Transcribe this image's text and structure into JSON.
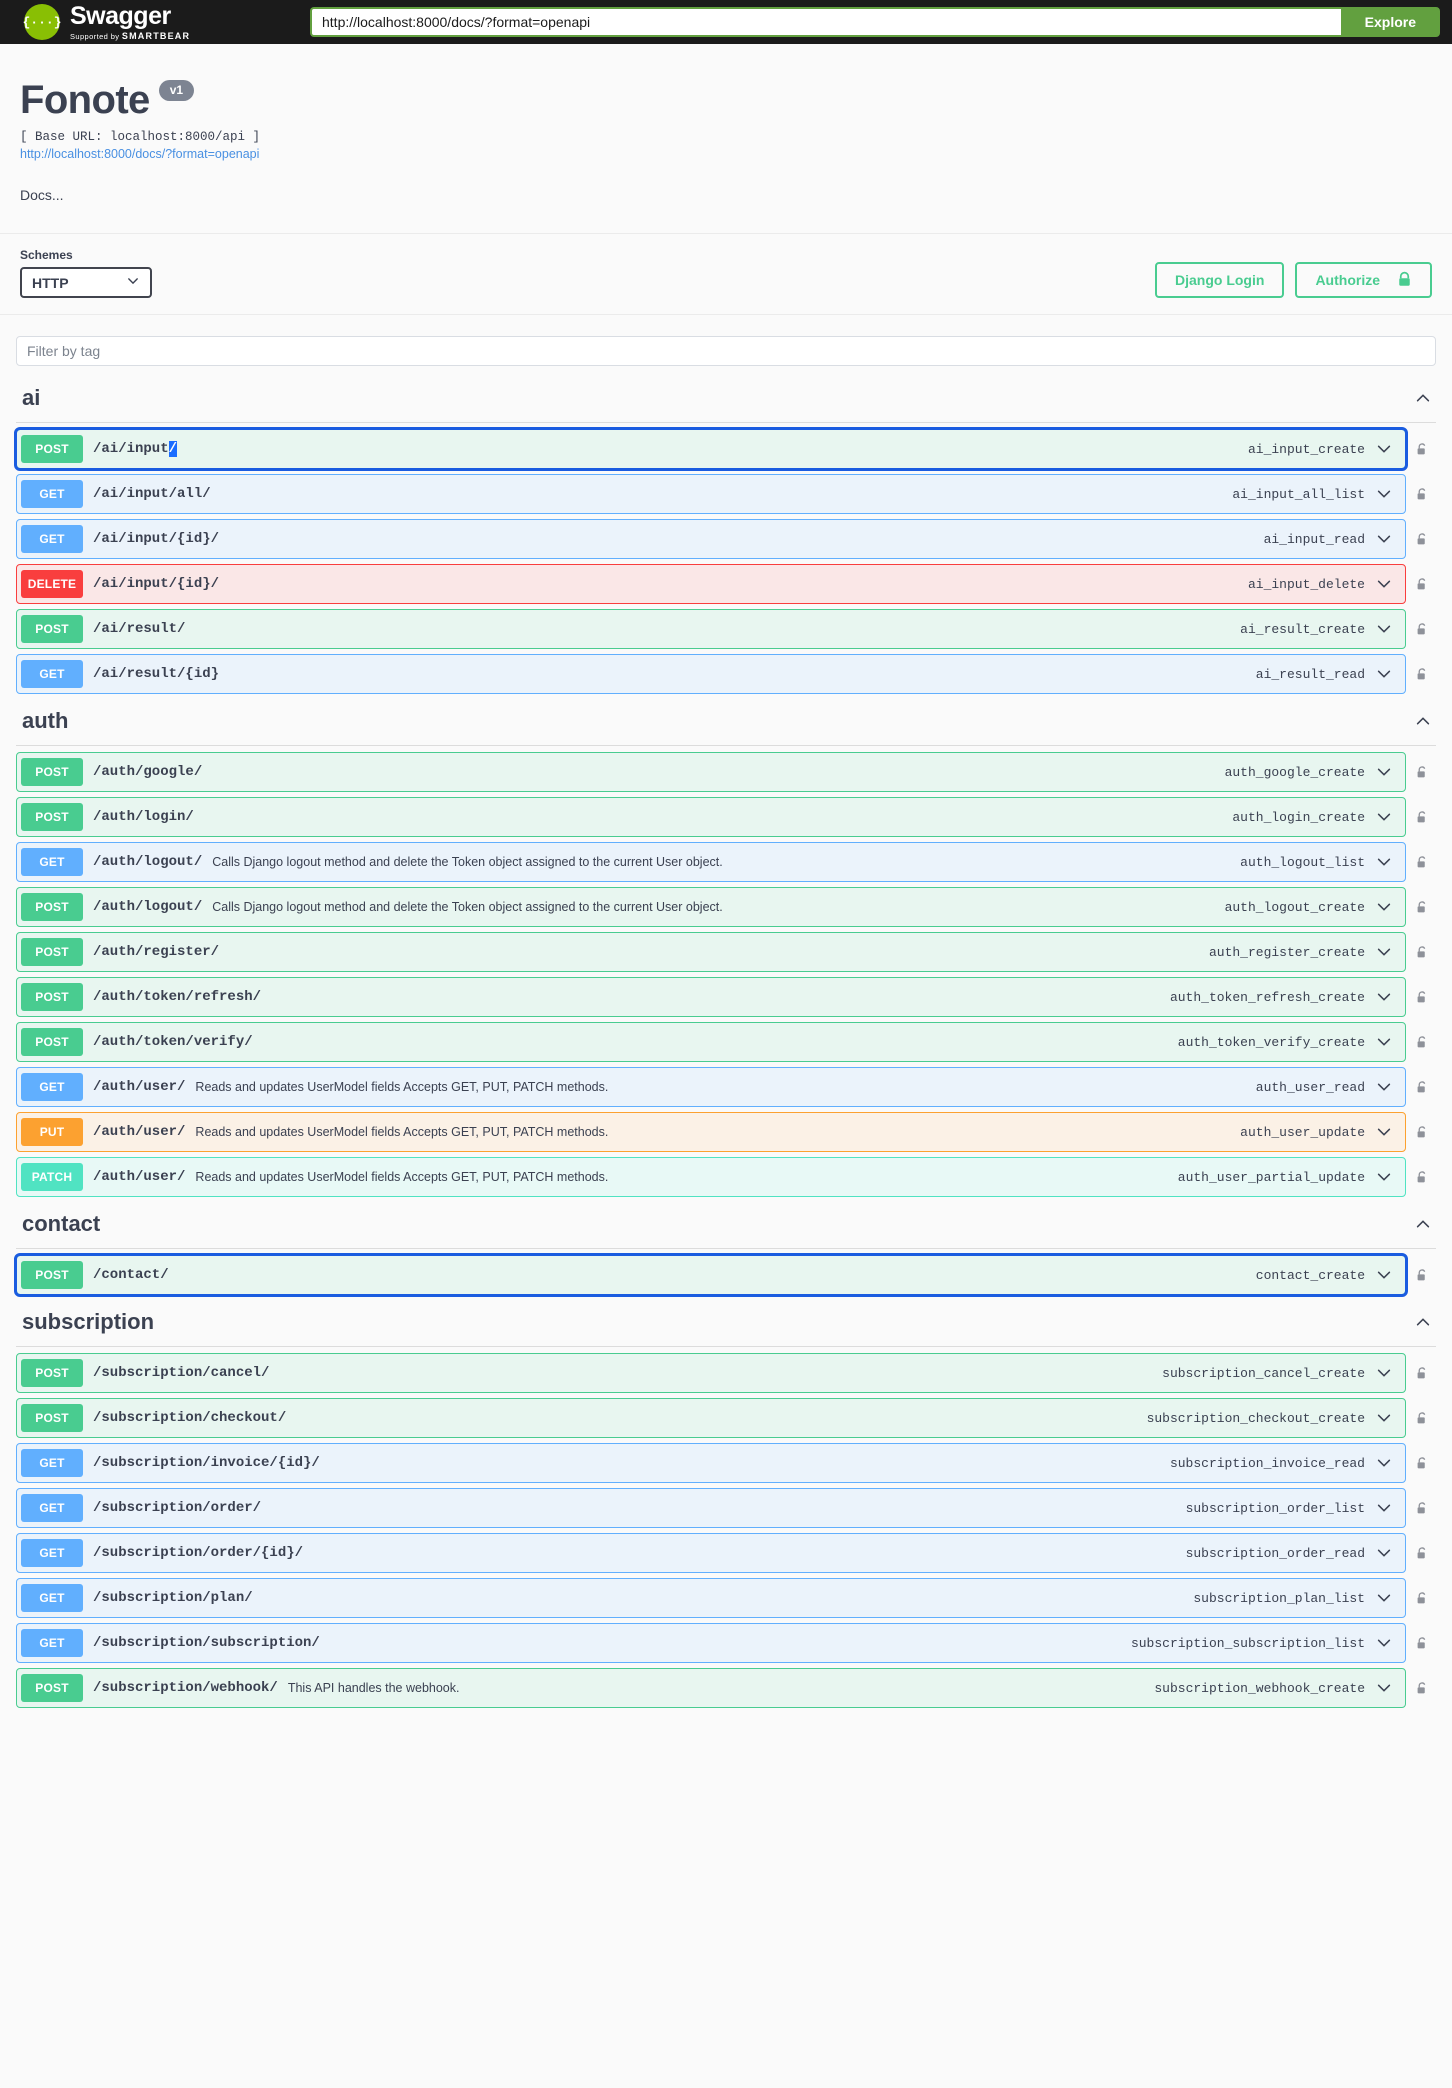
{
  "topbar": {
    "logo_title": "Swagger",
    "logo_supported_prefix": "Supported by",
    "logo_supported_brand": "SMARTBEAR",
    "logo_mark_glyph": "{···}",
    "url_value": "http://localhost:8000/docs/?format=openapi",
    "url_placeholder": "http://localhost:8000/docs/?format=openapi",
    "explore_label": "Explore"
  },
  "info": {
    "title": "Fonote",
    "version": "v1",
    "base_url": "[ Base URL: localhost:8000/api ]",
    "spec_link": "http://localhost:8000/docs/?format=openapi",
    "description": "Docs..."
  },
  "schemes": {
    "label": "Schemes",
    "selected": "HTTP",
    "options": [
      "HTTP"
    ]
  },
  "auth": {
    "django_login_label": "Django Login",
    "authorize_label": "Authorize",
    "lock_icon": "lock-closed-icon"
  },
  "filter": {
    "placeholder": "Filter by tag",
    "value": ""
  },
  "colors": {
    "post": "#49cc90",
    "get": "#61affe",
    "delete": "#f93e3e",
    "put": "#fca130",
    "patch": "#50e3c2",
    "brand_green": "#89bf04",
    "explore_green": "#62a03f",
    "focus_blue": "#1a5ce0",
    "selection_blue": "#1a6dff"
  },
  "tags": [
    {
      "name": "ai",
      "collapse_icon": "chevron-up-icon",
      "operations": [
        {
          "verb": "POST",
          "path_main": "/ai/input",
          "path_tail": "/",
          "tail_selected": true,
          "desc": "",
          "op_id": "ai_input_create",
          "focused": true,
          "lock": "lock-open-icon"
        },
        {
          "verb": "GET",
          "path_main": "/ai/input/all/",
          "path_tail": "",
          "tail_selected": false,
          "desc": "",
          "op_id": "ai_input_all_list",
          "focused": false,
          "lock": "lock-open-icon"
        },
        {
          "verb": "GET",
          "path_main": "/ai/input/{id}/",
          "path_tail": "",
          "tail_selected": false,
          "desc": "",
          "op_id": "ai_input_read",
          "focused": false,
          "lock": "lock-open-icon"
        },
        {
          "verb": "DELETE",
          "path_main": "/ai/input/{id}/",
          "path_tail": "",
          "tail_selected": false,
          "desc": "",
          "op_id": "ai_input_delete",
          "focused": false,
          "lock": "lock-open-icon"
        },
        {
          "verb": "POST",
          "path_main": "/ai/result/",
          "path_tail": "",
          "tail_selected": false,
          "desc": "",
          "op_id": "ai_result_create",
          "focused": false,
          "lock": "lock-open-icon"
        },
        {
          "verb": "GET",
          "path_main": "/ai/result/{id}",
          "path_tail": "",
          "tail_selected": false,
          "desc": "",
          "op_id": "ai_result_read",
          "focused": false,
          "lock": "lock-open-icon"
        }
      ]
    },
    {
      "name": "auth",
      "collapse_icon": "chevron-up-icon",
      "operations": [
        {
          "verb": "POST",
          "path_main": "/auth/google/",
          "path_tail": "",
          "tail_selected": false,
          "desc": "",
          "op_id": "auth_google_create",
          "focused": false,
          "lock": "lock-open-icon"
        },
        {
          "verb": "POST",
          "path_main": "/auth/login/",
          "path_tail": "",
          "tail_selected": false,
          "desc": "",
          "op_id": "auth_login_create",
          "focused": false,
          "lock": "lock-open-icon"
        },
        {
          "verb": "GET",
          "path_main": "/auth/logout/",
          "path_tail": "",
          "tail_selected": false,
          "desc": "Calls Django logout method and delete the Token object assigned to the current User object.",
          "op_id": "auth_logout_list",
          "focused": false,
          "lock": "lock-open-icon"
        },
        {
          "verb": "POST",
          "path_main": "/auth/logout/",
          "path_tail": "",
          "tail_selected": false,
          "desc": "Calls Django logout method and delete the Token object assigned to the current User object.",
          "op_id": "auth_logout_create",
          "focused": false,
          "lock": "lock-open-icon"
        },
        {
          "verb": "POST",
          "path_main": "/auth/register/",
          "path_tail": "",
          "tail_selected": false,
          "desc": "",
          "op_id": "auth_register_create",
          "focused": false,
          "lock": "lock-open-icon"
        },
        {
          "verb": "POST",
          "path_main": "/auth/token/refresh/",
          "path_tail": "",
          "tail_selected": false,
          "desc": "",
          "op_id": "auth_token_refresh_create",
          "focused": false,
          "lock": "lock-open-icon"
        },
        {
          "verb": "POST",
          "path_main": "/auth/token/verify/",
          "path_tail": "",
          "tail_selected": false,
          "desc": "",
          "op_id": "auth_token_verify_create",
          "focused": false,
          "lock": "lock-open-icon"
        },
        {
          "verb": "GET",
          "path_main": "/auth/user/",
          "path_tail": "",
          "tail_selected": false,
          "desc": "Reads and updates UserModel fields Accepts GET, PUT, PATCH methods.",
          "op_id": "auth_user_read",
          "focused": false,
          "lock": "lock-open-icon"
        },
        {
          "verb": "PUT",
          "path_main": "/auth/user/",
          "path_tail": "",
          "tail_selected": false,
          "desc": "Reads and updates UserModel fields Accepts GET, PUT, PATCH methods.",
          "op_id": "auth_user_update",
          "focused": false,
          "lock": "lock-open-icon"
        },
        {
          "verb": "PATCH",
          "path_main": "/auth/user/",
          "path_tail": "",
          "tail_selected": false,
          "desc": "Reads and updates UserModel fields Accepts GET, PUT, PATCH methods.",
          "op_id": "auth_user_partial_update",
          "focused": false,
          "lock": "lock-open-icon"
        }
      ]
    },
    {
      "name": "contact",
      "collapse_icon": "chevron-up-icon",
      "operations": [
        {
          "verb": "POST",
          "path_main": "/contact/",
          "path_tail": "",
          "tail_selected": false,
          "desc": "",
          "op_id": "contact_create",
          "focused": true,
          "lock": "lock-open-icon"
        }
      ]
    },
    {
      "name": "subscription",
      "collapse_icon": "chevron-up-icon",
      "operations": [
        {
          "verb": "POST",
          "path_main": "/subscription/cancel/",
          "path_tail": "",
          "tail_selected": false,
          "desc": "",
          "op_id": "subscription_cancel_create",
          "focused": false,
          "lock": "lock-open-icon"
        },
        {
          "verb": "POST",
          "path_main": "/subscription/checkout/",
          "path_tail": "",
          "tail_selected": false,
          "desc": "",
          "op_id": "subscription_checkout_create",
          "focused": false,
          "lock": "lock-open-icon"
        },
        {
          "verb": "GET",
          "path_main": "/subscription/invoice/{id}/",
          "path_tail": "",
          "tail_selected": false,
          "desc": "",
          "op_id": "subscription_invoice_read",
          "focused": false,
          "lock": "lock-open-icon"
        },
        {
          "verb": "GET",
          "path_main": "/subscription/order/",
          "path_tail": "",
          "tail_selected": false,
          "desc": "",
          "op_id": "subscription_order_list",
          "focused": false,
          "lock": "lock-open-icon"
        },
        {
          "verb": "GET",
          "path_main": "/subscription/order/{id}/",
          "path_tail": "",
          "tail_selected": false,
          "desc": "",
          "op_id": "subscription_order_read",
          "focused": false,
          "lock": "lock-open-icon"
        },
        {
          "verb": "GET",
          "path_main": "/subscription/plan/",
          "path_tail": "",
          "tail_selected": false,
          "desc": "",
          "op_id": "subscription_plan_list",
          "focused": false,
          "lock": "lock-open-icon"
        },
        {
          "verb": "GET",
          "path_main": "/subscription/subscription/",
          "path_tail": "",
          "tail_selected": false,
          "desc": "",
          "op_id": "subscription_subscription_list",
          "focused": false,
          "lock": "lock-open-icon"
        },
        {
          "verb": "POST",
          "path_main": "/subscription/webhook/",
          "path_tail": "",
          "tail_selected": false,
          "desc": "This API handles the webhook.",
          "op_id": "subscription_webhook_create",
          "focused": false,
          "lock": "lock-open-icon"
        }
      ]
    }
  ]
}
